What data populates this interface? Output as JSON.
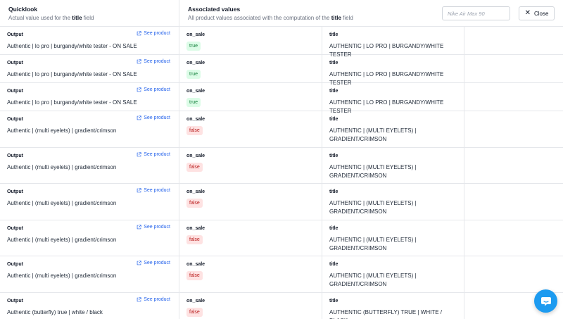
{
  "header": {
    "quicklook_title": "Quicklook",
    "quicklook_sub_prefix": "Actual value used for the",
    "quicklook_sub_field": "title",
    "quicklook_sub_suffix": "field",
    "assoc_title": "Associated values",
    "assoc_sub_prefix": "All product values associated with the computation of the",
    "assoc_sub_field": "title",
    "assoc_sub_suffix": "field",
    "search_placeholder": "Nike Air Max 90",
    "close_label": "Close"
  },
  "labels": {
    "output": "Output",
    "see_product": "See product",
    "on_sale": "on_sale",
    "title": "title"
  },
  "rows": [
    {
      "output": "Authentic | lo pro | burgandy/white tester - ON SALE",
      "on_sale": "true",
      "title": "AUTHENTIC | LO PRO | BURGANDY/WHITE TESTER"
    },
    {
      "output": "Authentic | lo pro | burgandy/white tester - ON SALE",
      "on_sale": "true",
      "title": "AUTHENTIC | LO PRO | BURGANDY/WHITE TESTER"
    },
    {
      "output": "Authentic | lo pro | burgandy/white tester - ON SALE",
      "on_sale": "true",
      "title": "AUTHENTIC | LO PRO | BURGANDY/WHITE TESTER"
    },
    {
      "output": "Authentic | (multi eyelets) | gradient/crimson",
      "on_sale": "false",
      "title": "AUTHENTIC | (MULTI EYELETS) | GRADIENT/CRIMSON"
    },
    {
      "output": "Authentic | (multi eyelets) | gradient/crimson",
      "on_sale": "false",
      "title": "AUTHENTIC | (MULTI EYELETS) | GRADIENT/CRIMSON"
    },
    {
      "output": "Authentic | (multi eyelets) | gradient/crimson",
      "on_sale": "false",
      "title": "AUTHENTIC | (MULTI EYELETS) | GRADIENT/CRIMSON"
    },
    {
      "output": "Authentic | (multi eyelets) | gradient/crimson",
      "on_sale": "false",
      "title": "AUTHENTIC | (MULTI EYELETS) | GRADIENT/CRIMSON"
    },
    {
      "output": "Authentic | (multi eyelets) | gradient/crimson",
      "on_sale": "false",
      "title": "AUTHENTIC | (MULTI EYELETS) | GRADIENT/CRIMSON"
    },
    {
      "output": "Authentic (butterfly) true | white / black",
      "on_sale": "false",
      "title": "AUTHENTIC (BUTTERFLY) TRUE | WHITE / BLACK"
    }
  ],
  "colors": {
    "link": "#2563eb",
    "true_badge_bg": "#dcfce7",
    "true_badge_text": "#15803d",
    "false_badge_bg": "#fee2e2",
    "false_badge_text": "#b91c1c",
    "chat_button": "#1d9bf0"
  },
  "icons": {
    "see_product": "external-link-icon",
    "close": "close-icon",
    "chat": "chat-bubble-icon"
  }
}
